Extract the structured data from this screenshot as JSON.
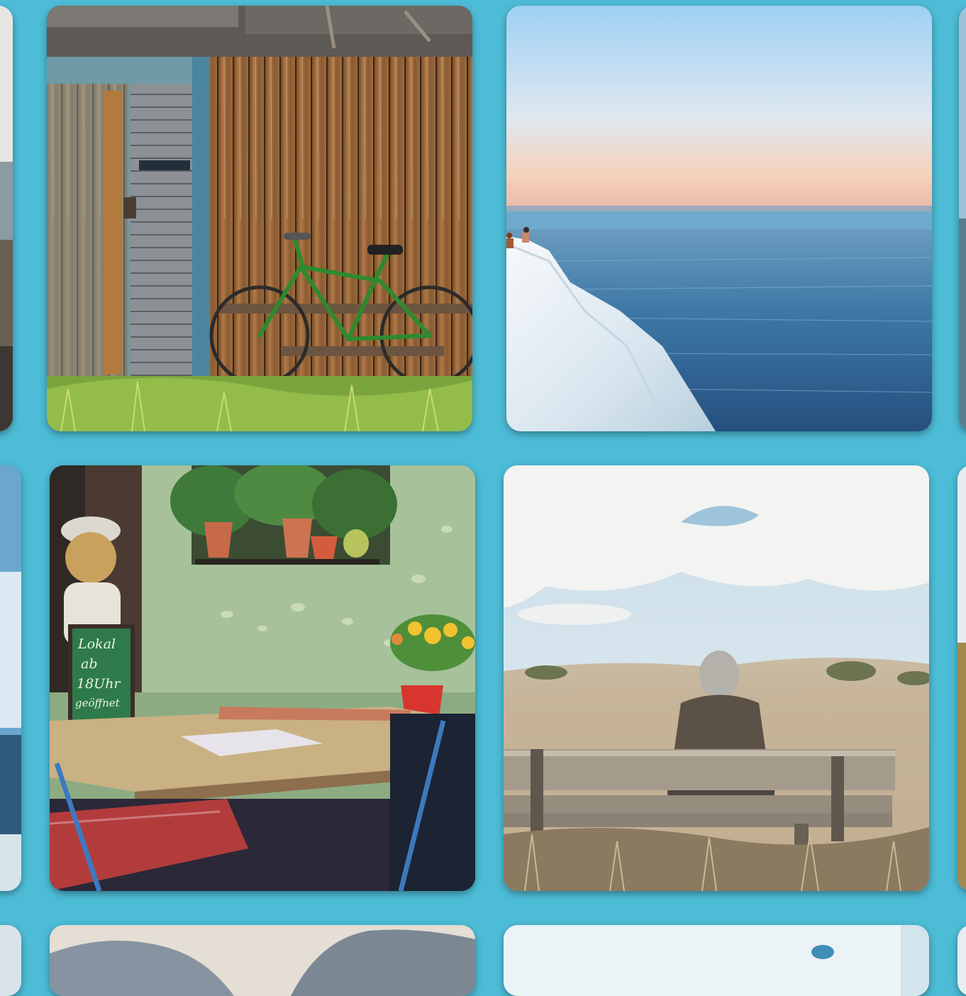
{
  "page": {
    "background_color": "#4dbcd6"
  },
  "grid": {
    "rows": [
      {
        "tiles": [
          {
            "subject": "partial-photo-left-edge"
          },
          {
            "subject": "wooden-shed-with-green-bicycle"
          },
          {
            "subject": "white-cliff-over-sea"
          },
          {
            "subject": "partial-photo-right-edge"
          }
        ]
      },
      {
        "tiles": [
          {
            "subject": "partial-photo-left-edge"
          },
          {
            "subject": "cafe-terrace-with-chalkboard"
          },
          {
            "subject": "person-on-bench-facing-dunes"
          },
          {
            "subject": "partial-photo-right-edge"
          }
        ]
      },
      {
        "tiles": [
          {
            "subject": "partial-photo-left-edge"
          },
          {
            "subject": "mountain-photo-top"
          },
          {
            "subject": "sky-photo-top"
          },
          {
            "subject": "partial-photo-right-edge"
          }
        ]
      }
    ]
  },
  "chalkboard": {
    "line1": "Lokal",
    "line2": "ab",
    "line3": "18Uhr",
    "line4": "geöffnet"
  }
}
